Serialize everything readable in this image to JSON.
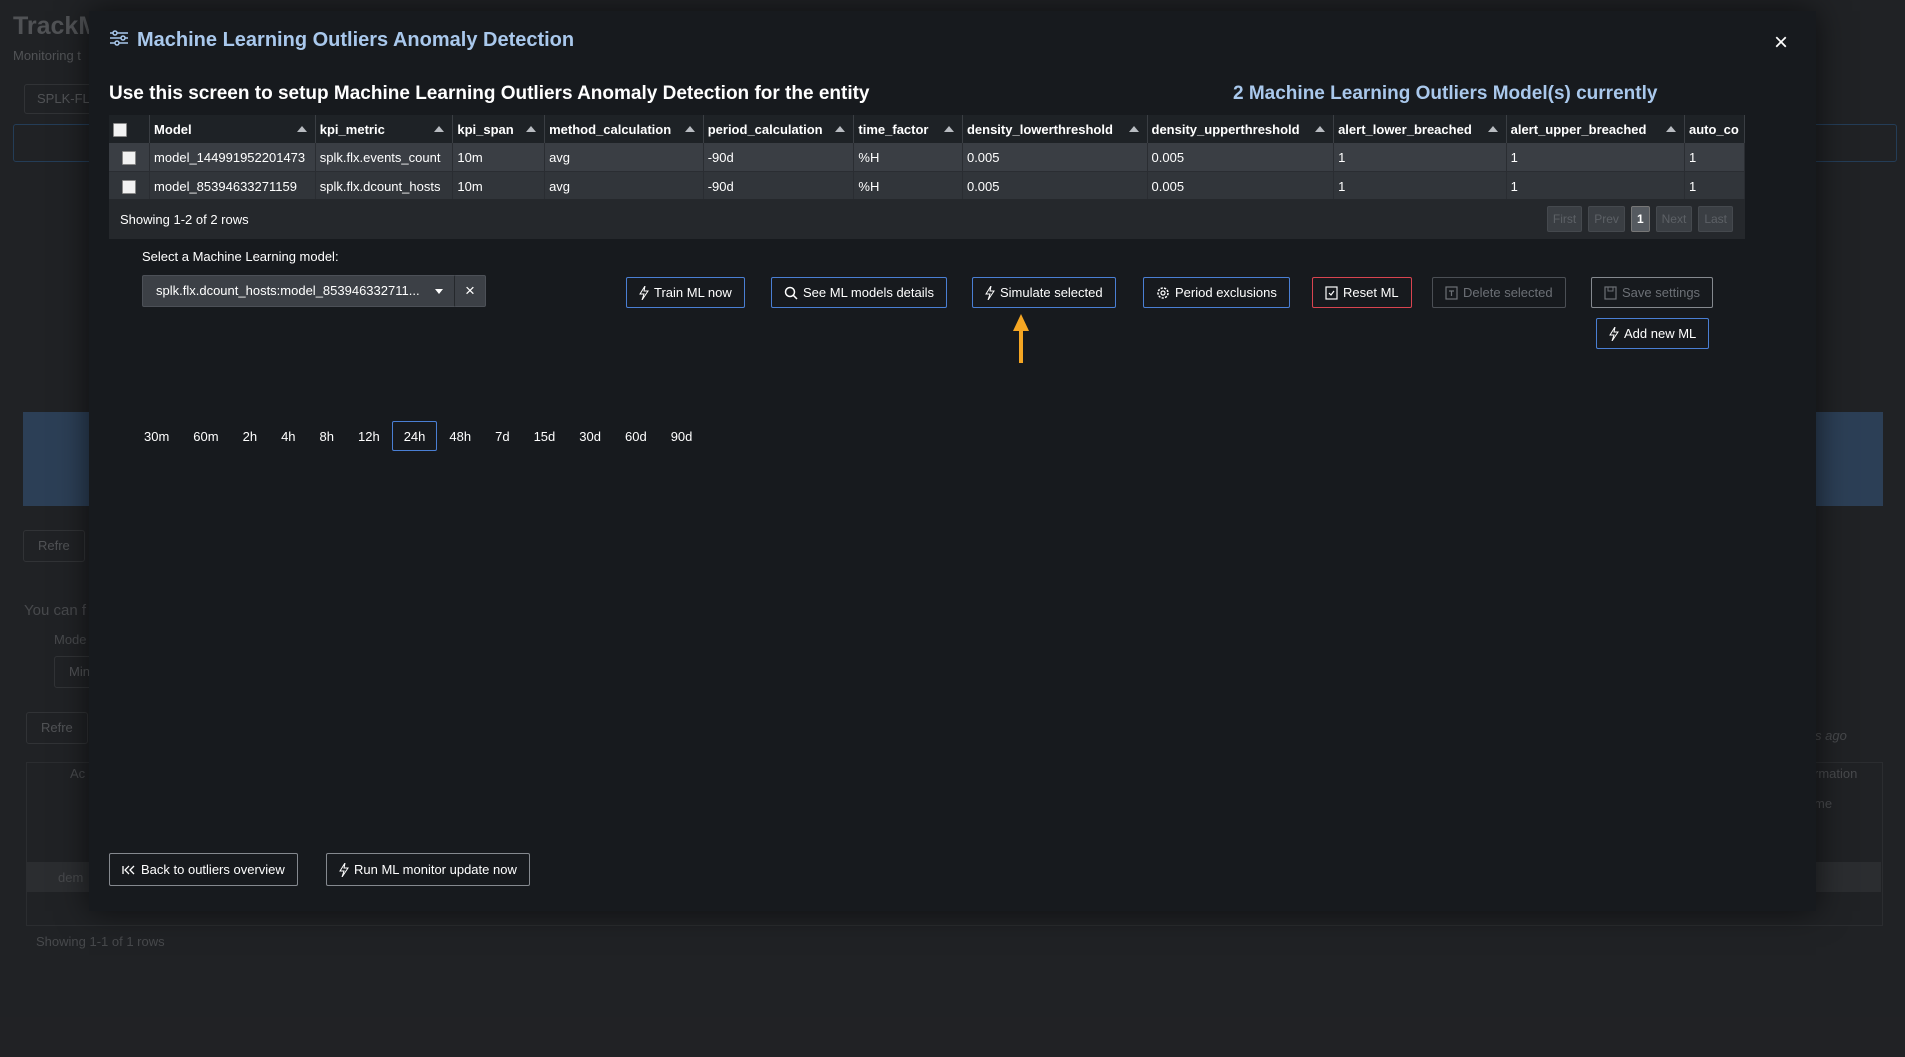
{
  "background": {
    "title": "TrackM",
    "subtitle": "Monitoring t",
    "tab": "SPLK-FL",
    "refresh1": "Refre",
    "refresh2": "Refre",
    "text_you_can": "You can f",
    "text_mode": "Mode",
    "text_min": "Min",
    "text_ago": "s ago",
    "text_information": "rmation",
    "text_me": "me",
    "text_act": "Ac",
    "text_dem": "dem",
    "footer": "Showing 1-1 of 1 rows"
  },
  "modal": {
    "title": "Machine Learning Outliers Anomaly Detection",
    "intro": "Use this screen to setup Machine Learning Outliers Anomaly Detection for the entity",
    "model_count": "2 Machine Learning Outliers Model(s) currently",
    "close": "×"
  },
  "table": {
    "columns": [
      "Model",
      "kpi_metric",
      "kpi_span",
      "method_calculation",
      "period_calculation",
      "time_factor",
      "density_lowerthreshold",
      "density_upperthreshold",
      "alert_lower_breached",
      "alert_upper_breached",
      "auto_co"
    ],
    "rows": [
      [
        "model_144991952201473",
        "splk.flx.events_count",
        "10m",
        "avg",
        "-90d",
        "%H",
        "0.005",
        "0.005",
        "1",
        "1",
        "1"
      ],
      [
        "model_85394633271159",
        "splk.flx.dcount_hosts",
        "10m",
        "avg",
        "-90d",
        "%H",
        "0.005",
        "0.005",
        "1",
        "1",
        "1"
      ]
    ],
    "rows_info": "Showing 1-2 of 2 rows",
    "pager": {
      "first": "First",
      "prev": "Prev",
      "page": "1",
      "next": "Next",
      "last": "Last"
    }
  },
  "selector": {
    "label": "Select a Machine Learning model:",
    "value": "splk.flx.dcount_hosts:model_853946332711...",
    "clear": "×"
  },
  "buttons": {
    "train": "Train ML now",
    "details": "See ML models details",
    "simulate": "Simulate selected",
    "exclusions": "Period exclusions",
    "reset": "Reset ML",
    "delete": "Delete selected",
    "save": "Save settings",
    "add": "Add new ML",
    "back": "Back to outliers overview",
    "run": "Run ML monitor update now"
  },
  "timeranges": [
    "30m",
    "60m",
    "2h",
    "4h",
    "8h",
    "12h",
    "24h",
    "48h",
    "7d",
    "15d",
    "30d",
    "60d",
    "90d"
  ],
  "timerange_selected": "24h",
  "colors": {
    "accent": "#4a7fd4",
    "title_blue": "#a9c8ec",
    "danger": "#d94450",
    "arrow": "#f5a623"
  }
}
